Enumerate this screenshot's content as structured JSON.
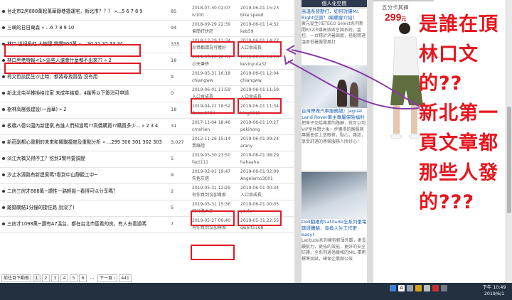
{
  "forum": {
    "rows": [
      {
        "title": "台北市2房888萬起萬華靜巷捷運宅，新北市？？？ »...5 6 7 8 9",
        "count": "85",
        "post_date": "2018-07-30 02:07",
        "post_user": "iv100",
        "last_date": "2019-06-01 15:23",
        "last_user": "bike speed"
      },
      {
        "title": "三峽的日日東森 » ...6 7 8 9 10",
        "count": "94",
        "post_date": "2018-09-29 22:39",
        "post_user": "曾簡打拼莊",
        "last_date": "2019-06-01 14:32",
        "last_user": "keb59"
      },
      {
        "title": "林口 世紀長虹 大樹建 樂購900萬 » ...30 31 32 33 34",
        "count": "335",
        "post_date": "2018-12-29 11:34",
        "post_user": "珍惜都謂為可獲好",
        "last_date": "2019-06-01 14:27",
        "last_user": "入口食成長"
      },
      {
        "title": "林口黑老特輸<1>這些人還會什麼都不出來?? » 2",
        "count": "18",
        "post_date": "2019-05-20 18:01",
        "post_user": "小天筆終",
        "last_date": "2019-06-01 14:16",
        "last_user": "kevinyuta32"
      },
      {
        "title": "柯文哲談民生沙止時：都將尋找冒晶 沒有用",
        "count": "9",
        "post_date": "2019-05-31 16:18",
        "post_user": "chiangww",
        "last_date": "2019-06-01 12:04",
        "last_user": "chiangww"
      },
      {
        "title": "新北北屯半推換格垃家 未成年結婚，4幾等以下簽消可申請",
        "count": "0",
        "post_date": "2019-06-01 11:59",
        "post_user": "入口食成長",
        "last_date": "2019-06-01 11:59",
        "last_user": "入口食成長"
      },
      {
        "title": "樹林高層張建設(一品華) » 2",
        "count": "18",
        "post_date": "2019-04-22 18:52",
        "post_user": "Oscar3734",
        "last_date": "2019-06-01 11:34",
        "last_user": "hing0315"
      },
      {
        "title": "板橋八德公園內新建案,有誰人們知道嗎??高價購買??購買多少... » 2 3 4",
        "count": "31",
        "post_date": "2017-11-04 18:46",
        "post_user": "cmshien",
        "last_date": "2019-06-01 10:27",
        "last_user": "pekihong"
      },
      {
        "title": "新莊副都心重劃的未來和關聯捷度及重點分析 » ...299 300 301 302 303",
        "count": "3,027",
        "post_date": "2012-11-26 15:14",
        "post_user": "賣綠隱",
        "last_date": "2019-06-01 09:24",
        "last_user": "arany"
      },
      {
        "title": "淡江大橋又得停工？挖到3警吟要調變",
        "count": "5",
        "post_date": "2019-05-30 23:50",
        "post_user": "fact111",
        "last_date": "2019-06-01 08:29",
        "last_user": "hahaaha"
      },
      {
        "title": "汐止水源路有新建案嗎?看到中山靜觀工中~",
        "count": "9",
        "post_date": "2019-02-01 19:47",
        "post_user": "失色灰塔",
        "last_date": "2019-06-01 02:09",
        "last_user": "Angelarno3001"
      },
      {
        "title": "二房三房才888萬~讚性一路輕鬆~看得可以分享嗎？",
        "count": "2",
        "post_date": "2019-05-31 12:29",
        "post_user": "有你買到沒卻專家",
        "last_date": "2019-06-01 00:34",
        "last_user": "入口食成長"
      },
      {
        "title": "離婚關結1分鐘的捷住路 說沒了!",
        "count": "5",
        "post_date": "2019-05-31 15:36",
        "post_user": "紅分路大王",
        "last_date": "2019-06-01 00:05",
        "last_user": "yeeler"
      },
      {
        "title": "三房才1098萬~讚有A7溫台，都在台北市區看的房，有人去看過嗎",
        "count": "7",
        "post_date": "2019-05-27 09:40",
        "post_user": "有你買到沒卻專家",
        "last_date": "2019-05-31 22:55",
        "last_user": "qwert5168"
      }
    ],
    "pagination": [
      "前往目下動態",
      "1",
      "2",
      "3",
      "4",
      "5",
      "6",
      "...",
      "下一頁 ›",
      "441"
    ]
  },
  "sidebar": {
    "header": "個人化空間",
    "ad1_title": "高溫系發動打，如何說讓Mr. Right空調？(編輯會介紹)",
    "ad1_body": "東元從生(伍TECO Select系列新開R32冷媒高效區空調系統，溫控，一台精於消暑調度，搭配精選溫區低暑嚴發風打",
    "ad2_title": "台灣俾做汽車服務總）Jaguar Land Rover車主專屬保險福利",
    "ad2_body": "把車子交給專業的路顧，就可以到VIP室休憩之後一步獲得的路服務專屬會促上放眼茶，點心，雜誌，享受舒適的尊榮服務人所好心！",
    "ad3_title": "Dell翻維你Latitude全系列筆電篩證體驗，竟換人生工作更easy!",
    "ad3_body": "Latitude系列擁有輕薄外觀，更長續航力，更強的效能，更好的安全防護，全系列通過嚴格的MIL-軍用標準測試，確保企業辦公效"
  },
  "shop": {
    "caption": "五分卡其褲",
    "price": "299",
    "price_unit": "元"
  },
  "annotation": {
    "lines": [
      "是誰在頂",
      "林口文",
      "的??",
      "新北第一",
      "頁文章都",
      "那些人發",
      "的???"
    ]
  },
  "taskbar": {
    "time": "下午 10:49",
    "date": "2019/6/1"
  },
  "colors": {
    "highlight": "#e11926",
    "annotation_text": "#e6161e",
    "arrow": "#8b3aa8",
    "taskbar": "#22303f",
    "price": "#d8141a"
  }
}
